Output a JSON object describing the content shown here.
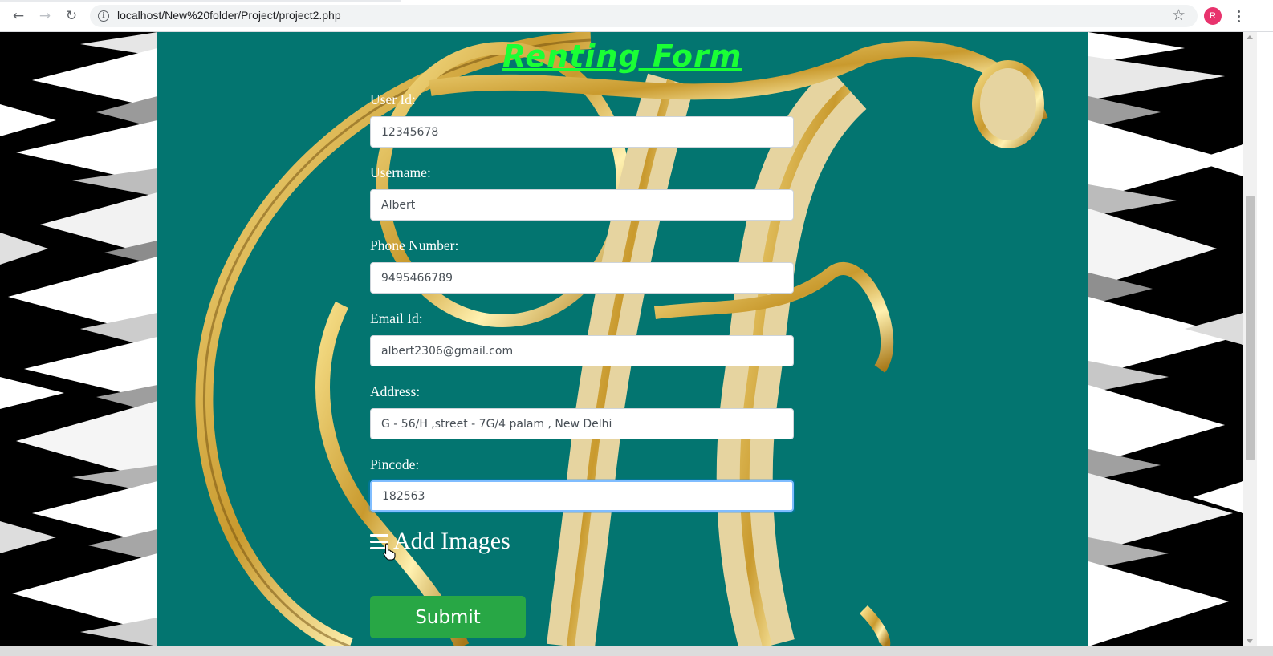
{
  "browser": {
    "url": "localhost/New%20folder/Project/project2.php",
    "avatar_letter": "R",
    "back_icon": "arrow-left-icon",
    "forward_icon": "arrow-right-icon",
    "reload_icon": "reload-icon",
    "bookmark_icon": "star-icon",
    "menu_icon": "vertical-dots-icon"
  },
  "form": {
    "title": "Renting Form",
    "fields": [
      {
        "label": "User Id:",
        "value": "12345678"
      },
      {
        "label": "Username:",
        "value": "Albert"
      },
      {
        "label": "Phone Number:",
        "value": "9495466789"
      },
      {
        "label": "Email Id:",
        "value": "albert2306@gmail.com"
      },
      {
        "label": "Address:",
        "value": "G - 56/H ,street - 7G/4 palam , New Delhi"
      },
      {
        "label": "Pincode:",
        "value": "182563"
      }
    ],
    "add_images_label": "Add Images",
    "submit_label": "Submit"
  },
  "colors": {
    "panel_background": "#037570",
    "title": "#1aff35",
    "submit_button": "#28a745",
    "avatar": "#e8336d"
  }
}
